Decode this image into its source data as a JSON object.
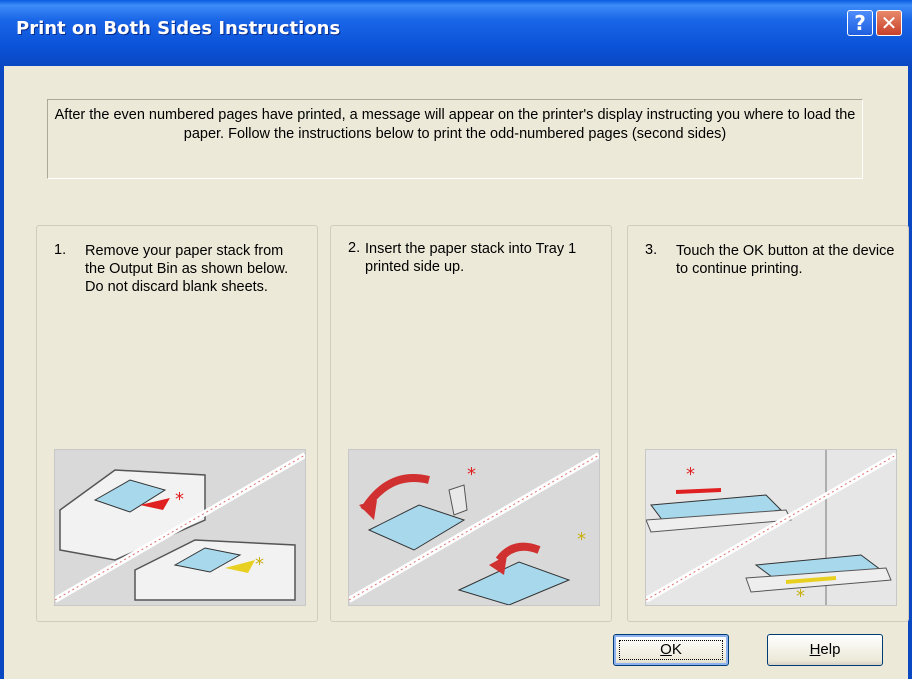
{
  "window": {
    "title": "Print on Both Sides Instructions",
    "help_glyph": "?",
    "close_glyph": "✕"
  },
  "intro_text": "After the even numbered pages have printed, a message will appear on the printer's display instructing you where to load the paper. Follow the instructions below to print the odd-numbered pages (second sides)",
  "steps": [
    {
      "number": "1.",
      "text": "Remove your paper stack from the Output Bin as shown below.  Do not discard blank sheets.",
      "illustration": "output-bin-illustration"
    },
    {
      "number": "2.",
      "text": "Insert the paper stack into Tray 1 printed side up.",
      "illustration": "tray-insert-illustration"
    },
    {
      "number": "3.",
      "text": "Touch the OK button at the device to continue printing.",
      "illustration": "tray-feed-illustration"
    }
  ],
  "buttons": {
    "ok_mnemonic": "O",
    "ok_rest": "K",
    "help_mnemonic": "H",
    "help_rest": "elp"
  },
  "colors": {
    "title_bar": "#0b53d8",
    "dialog_bg": "#ece9d8",
    "accent_red": "#e02020",
    "accent_yellow": "#e8d020"
  }
}
